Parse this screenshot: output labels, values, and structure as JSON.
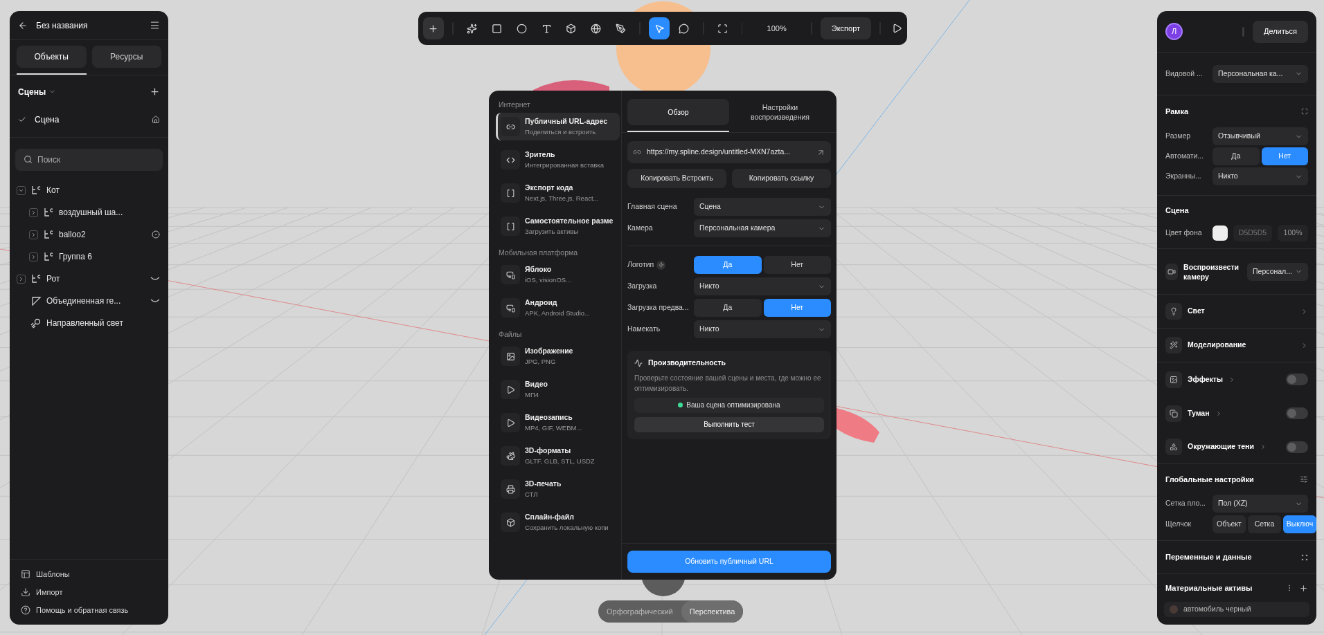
{
  "left_panel": {
    "title": "Без названия",
    "tabs": [
      {
        "label": "Объекты",
        "selected": true
      },
      {
        "label": "Ресурсы",
        "selected": false
      }
    ],
    "scenes_title": "Сцены",
    "scenes": [
      {
        "label": "Сцена",
        "selected": true
      }
    ],
    "search": {
      "placeholder": "Поиск"
    },
    "tree": [
      {
        "label": "Кот",
        "kind": "group",
        "expanded": true,
        "hidden": false,
        "targeted": false,
        "children": [
          {
            "label": "воздушный ша...",
            "kind": "group",
            "expanded": false,
            "hidden": false,
            "targeted": false
          },
          {
            "label": "balloo2",
            "kind": "group",
            "expanded": false,
            "hidden": false,
            "targeted": true
          },
          {
            "label": "Группа 6",
            "kind": "group",
            "expanded": false,
            "hidden": false,
            "targeted": false
          }
        ]
      },
      {
        "label": "Рот",
        "kind": "group",
        "expanded": false,
        "hidden": true,
        "targeted": false
      },
      {
        "label": "Объединенная ге...",
        "kind": "shape",
        "hidden": true,
        "targeted": false
      },
      {
        "label": "Направленный свет",
        "kind": "light",
        "hidden": false,
        "targeted": false
      }
    ],
    "footer": [
      {
        "label": "Шаблоны",
        "kind": "templates"
      },
      {
        "label": "Импорт",
        "kind": "import"
      },
      {
        "label": "Помощь и обратная связь",
        "kind": "help"
      }
    ]
  },
  "toolbar": {
    "tool_groups": [
      [
        {
          "kind": "add",
          "selected": false
        }
      ],
      [
        {
          "kind": "sparkles",
          "selected": false
        },
        {
          "kind": "rectangle",
          "selected": false
        },
        {
          "kind": "ellipse",
          "selected": false
        },
        {
          "kind": "text",
          "selected": false
        },
        {
          "kind": "cube",
          "selected": false
        },
        {
          "kind": "sphere",
          "selected": false
        },
        {
          "kind": "pen",
          "selected": false
        }
      ],
      [
        {
          "kind": "pointer",
          "selected": true
        },
        {
          "kind": "comment",
          "selected": false
        }
      ],
      [
        {
          "kind": "frame",
          "selected": false
        }
      ]
    ],
    "zoom": "100%",
    "export": "Экспорт"
  },
  "export_dialog": {
    "sections": [
      {
        "title": "Интернет",
        "items": [
          {
            "title": "Публичный URL-адрес",
            "subtitle": "Поделиться и встроить",
            "kind": "link",
            "selected": true
          },
          {
            "title": "Зритель",
            "subtitle": "Интегрированная вставка",
            "kind": "code",
            "selected": false
          },
          {
            "title": "Экспорт кода",
            "subtitle": "Next.js, Three.js, React...",
            "kind": "brackets",
            "selected": false
          },
          {
            "title": "Самостоятельное разме",
            "subtitle": "Загрузить активы",
            "kind": "brackets",
            "selected": false
          }
        ]
      },
      {
        "title": "Мобильная платформа",
        "items": [
          {
            "title": "Яблоко",
            "subtitle": "iOS, visionOS...",
            "kind": "devices",
            "selected": false
          },
          {
            "title": "Андроид",
            "subtitle": "APK, Android Studio...",
            "kind": "devices",
            "selected": false
          }
        ]
      },
      {
        "title": "Файлы",
        "items": [
          {
            "title": "Изображение",
            "subtitle": "JPG, PNG",
            "kind": "image",
            "selected": false
          },
          {
            "title": "Видео",
            "subtitle": "МП4",
            "kind": "play",
            "selected": false
          },
          {
            "title": "Видеозапись",
            "subtitle": "MP4, GIF, WEBM...",
            "kind": "play",
            "selected": false
          },
          {
            "title": "3D-форматы",
            "subtitle": "GLTF, GLB, STL, USDZ",
            "kind": "rabbit",
            "selected": false
          },
          {
            "title": "3D-печать",
            "subtitle": "СТЛ",
            "kind": "printer",
            "selected": false
          },
          {
            "title": "Сплайн-файл",
            "subtitle": "Сохранить локальную копи",
            "kind": "box",
            "selected": false
          }
        ]
      }
    ],
    "tabs": [
      {
        "label": "Обзор",
        "selected": true
      },
      {
        "label": "Настройки воспроизведения",
        "selected": false
      }
    ],
    "url": "https://my.spline.design/untitled-MXN7azta...",
    "copy_buttons": [
      "Копировать Встроить",
      "Копировать ссылку"
    ],
    "setting_groups": [
      [
        {
          "label": "Главная сцена",
          "kind": "select",
          "value": "Сцена"
        },
        {
          "label": "Камера",
          "kind": "select",
          "value": "Персональная камера"
        }
      ],
      [
        {
          "label": "Логотип",
          "kind": "toggle",
          "premium": true,
          "options": [
            {
              "label": "Да",
              "selected": true
            },
            {
              "label": "Нет",
              "selected": false
            }
          ]
        },
        {
          "label": "Загрузка",
          "kind": "select",
          "value": "Никто"
        },
        {
          "label": "Загрузка предва...",
          "kind": "toggle",
          "premium": false,
          "options": [
            {
              "label": "Да",
              "selected": false
            },
            {
              "label": "Нет",
              "selected": true
            }
          ]
        },
        {
          "label": "Намекать",
          "kind": "select",
          "value": "Никто"
        }
      ]
    ],
    "performance": {
      "title": "Производительность",
      "description": "Проверьте состояние вашей сцены и места, где можно ее оптимизировать.",
      "status": {
        "label": "Ваша сцена оптимизирована",
        "color": "#3ddc97"
      },
      "run_button": "Выполнить тест"
    },
    "update_button": "Обновить публичный URL"
  },
  "view_toggle": [
    {
      "label": "Орфографический",
      "selected": false
    },
    {
      "label": "Перспектива",
      "selected": true
    }
  ],
  "right_panel": {
    "avatar": "Л",
    "share": "Делиться",
    "viewport": {
      "label": "Видовой ...",
      "value": "Персональная ка..."
    },
    "frame": {
      "title": "Рамка",
      "rows": [
        {
          "label": "Размер",
          "kind": "select",
          "value": "Отзывчивый"
        },
        {
          "label": "Автомати...",
          "kind": "toggle",
          "options": [
            {
              "label": "Да",
              "selected": false
            },
            {
              "label": "Нет",
              "selected": true
            }
          ]
        },
        {
          "label": "Экранны...",
          "kind": "select",
          "value": "Никто"
        }
      ]
    },
    "scene": {
      "title": "Сцена",
      "background_label": "Цвет фона",
      "hex": "D5D5D5",
      "opacity": "100%"
    },
    "play_camera": {
      "label": "Воспроизвести камеру",
      "value": "Персонал..."
    },
    "items": [
      {
        "label": "Свет",
        "kind": "light"
      },
      {
        "label": "Моделирование",
        "kind": "modeling"
      },
      {
        "label": "Эффекты",
        "kind": "effects",
        "on": false
      },
      {
        "label": "Туман",
        "kind": "fog",
        "on": false
      },
      {
        "label": "Окружающие тени",
        "kind": "shadows",
        "on": false
      }
    ],
    "global": {
      "title": "Глобальные настройки",
      "grid": {
        "label": "Сетка пло...",
        "value": "Пол (XZ)"
      },
      "snap": {
        "label": "Щелчок",
        "options": [
          {
            "label": "Объект",
            "selected": false
          },
          {
            "label": "Сетка",
            "selected": false
          },
          {
            "label": "Выключ",
            "selected": true
          }
        ]
      }
    },
    "variables": "Переменные и данные",
    "materials": {
      "title": "Материальные активы",
      "items": [
        "автомобиль черный"
      ]
    }
  }
}
